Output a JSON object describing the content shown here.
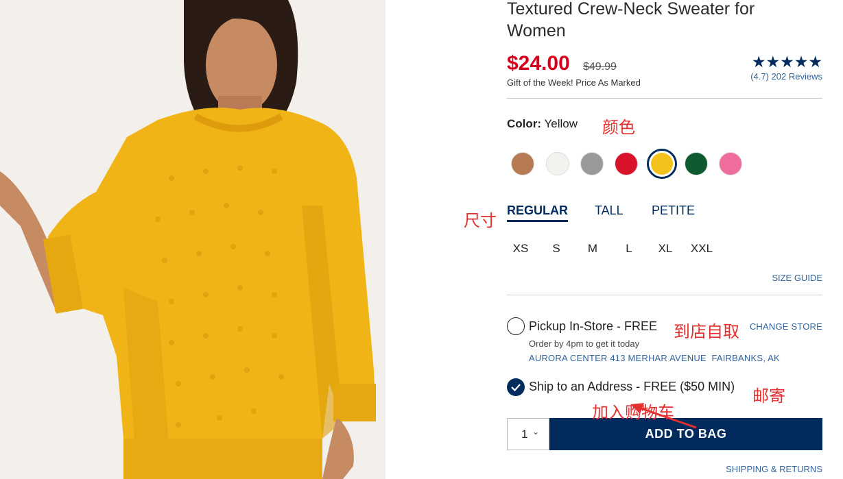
{
  "product": {
    "title": "Textured Crew-Neck Sweater for Women",
    "price": "$24.00",
    "original_price": "$49.99",
    "promo": "Gift of the Week! Price As Marked",
    "rating_stars": "★★★★★",
    "reviews": "(4.7) 202 Reviews"
  },
  "color": {
    "label": "Color:",
    "value": "Yellow",
    "swatches": [
      {
        "name": "tan",
        "hex": "#b87a52"
      },
      {
        "name": "white",
        "hex": "#f4f2ee"
      },
      {
        "name": "grey",
        "hex": "#9a9a9a"
      },
      {
        "name": "red",
        "hex": "#d9142a"
      },
      {
        "name": "yellow",
        "hex": "#f3c21a",
        "selected": true
      },
      {
        "name": "green",
        "hex": "#0f5a30"
      },
      {
        "name": "pink",
        "hex": "#ef6d9d"
      }
    ]
  },
  "fit": {
    "tabs": [
      "REGULAR",
      "TALL",
      "PETITE"
    ],
    "active": "REGULAR"
  },
  "sizes": [
    "XS",
    "S",
    "M",
    "L",
    "XL",
    "XXL"
  ],
  "size_guide": "SIZE GUIDE",
  "pickup": {
    "label": "Pickup In-Store - FREE",
    "change_store": "CHANGE STORE",
    "note": "Order by 4pm to get it today",
    "store": "AURORA CENTER 413 MERHAR AVENUE",
    "city": "FAIRBANKS, AK"
  },
  "ship": {
    "label": "Ship to an Address - FREE ($50 MIN)"
  },
  "cart": {
    "quantity": "1",
    "add_label": "ADD TO BAG"
  },
  "shipping_returns": "SHIPPING & RETURNS",
  "annotations": {
    "color": "颜色",
    "size": "尺寸",
    "pickup": "到店自取",
    "ship": "邮寄",
    "add": "加入购物车"
  },
  "colors": {
    "navy": "#002b5c",
    "sale_red": "#d6001c",
    "link": "#31639c",
    "annotation": "#e53030"
  }
}
